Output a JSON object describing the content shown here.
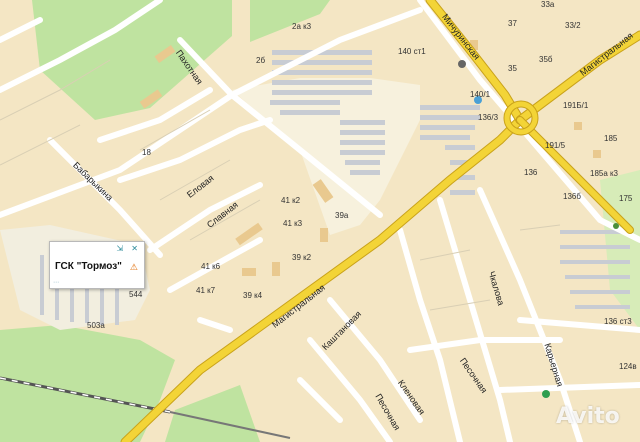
{
  "popup": {
    "title": "ГСК \"Тормоз\"",
    "icon": "warning-icon",
    "controls": "⇲ ✕"
  },
  "streets": {
    "pakhotnaya": "Пахотная",
    "michurinskaya": "Мичуринская",
    "magistralnaya_top": "Магистральная",
    "babaryknina": "Бабарыкина",
    "elovaya": "Еловая",
    "slavnaya": "Славная",
    "magistralnaya_bottom": "Магистральная",
    "chkalova": "Чкалова",
    "karyernaya": "Карьерная",
    "kashtanovaya": "Каштановая",
    "pesochnaya": "Песочная",
    "klenovaya": "Кленовая",
    "pesochnaya_bottom": "Песочная"
  },
  "house_numbers": {
    "n2ak3": "2а к3",
    "n2b": "2б",
    "n140st1": "140 ст1",
    "n37": "37",
    "n33a": "33а",
    "n33_2": "33/2",
    "n35": "35",
    "n35b": "35б",
    "n140_1": "140/1",
    "n136_3": "136/3",
    "n191b_1": "191Б/1",
    "n185": "185",
    "n191_5": "191/5",
    "n136": "136",
    "n185ak3": "185а к3",
    "n136b": "136б",
    "n175": "175",
    "n18": "18",
    "n41k2": "41 к2",
    "n39a": "39а",
    "n41k3": "41 к3",
    "n39k2": "39 к2",
    "n41k6": "41 к6",
    "n41k7": "41 к7",
    "n39k4": "39 к4",
    "n544": "544",
    "n503a": "503а",
    "n136st3": "136 ст3",
    "n124v": "124в"
  },
  "watermark": "Avito",
  "colors": {
    "block": "#f4e6c4",
    "street": "#ffffff",
    "main_road": "#f3d437",
    "park": "#bfe3a0",
    "garage": "#c8ccd3",
    "building": "#e9c98f",
    "popup_border": "#b9b9b9",
    "warning": "#e06a00"
  }
}
